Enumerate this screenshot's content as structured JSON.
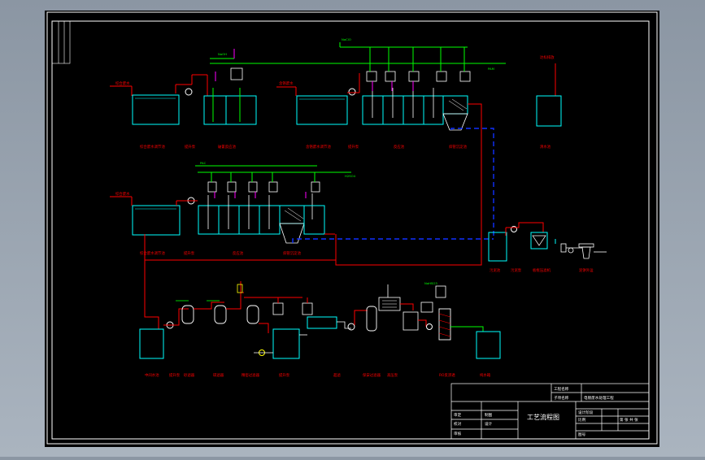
{
  "title_block": {
    "drawing_title": "工艺流程图",
    "project_label": "工程名称",
    "project_name": "电镀废水处理工程",
    "sub_item_label": "子项名称",
    "design_stage_label": "设计阶段",
    "scale_label": "比例",
    "sheet_label": "第 张 共 张",
    "drawing_no_label": "图号",
    "review_label": "审定",
    "check_label": "校对",
    "approve_label": "审核",
    "draw_label": "制图",
    "design_label": "设计"
  },
  "process_labels": {
    "row1": [
      "综合废水调节池",
      "提升泵",
      "破氰反应池",
      "含铬废水调节池",
      "提升泵",
      "反应池",
      "斜管沉淀池",
      "清水池"
    ],
    "row2": [
      "综合废水调节池",
      "提升泵",
      "反应池",
      "斜管沉淀池"
    ],
    "row3": [
      "中间水池",
      "提升泵",
      "砂滤器",
      "碳滤器",
      "精密过滤器",
      "提升泵",
      "超滤",
      "保安过滤器",
      "高压泵",
      "RO反渗透",
      "纯水箱"
    ],
    "sludge": [
      "污泥池",
      "污泥泵",
      "板框压滤机",
      "泥饼外运"
    ],
    "inlets": [
      "综合废水",
      "含铬废水",
      "达标排放"
    ],
    "dosing": [
      "NaOH",
      "NaClO",
      "PAM",
      "PAC",
      "H2SO4",
      "NaHSO3"
    ]
  },
  "colors": {
    "background": "#000000",
    "frame": "#ffffff",
    "water_line": "#ff0000",
    "tank": "#00ffff",
    "dosing_line": "#00ff00",
    "sludge_line": "#0000ff",
    "equipment": "#ffffff",
    "pump": "#ff0000",
    "valve": "#ff00ff",
    "label": "#ff0000"
  }
}
